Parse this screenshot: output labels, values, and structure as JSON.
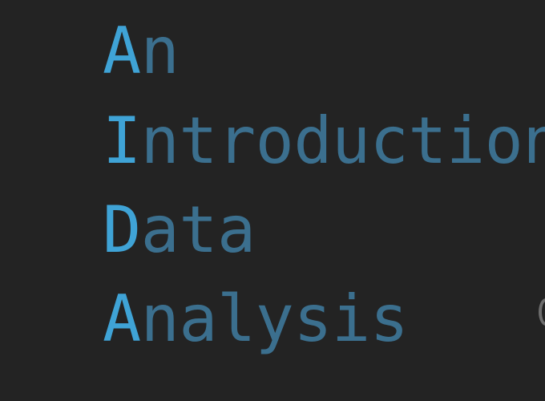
{
  "colors": {
    "background": "#232323",
    "accent": "#3fa3d6",
    "muted": "#3b6f8e"
  },
  "acrostic": [
    {
      "initial": "A",
      "rest": "n"
    },
    {
      "initial": "I",
      "rest": "ntroduction"
    },
    {
      "initial": "D",
      "rest": "ata"
    },
    {
      "initial": "A",
      "rest": "nalysis"
    }
  ]
}
